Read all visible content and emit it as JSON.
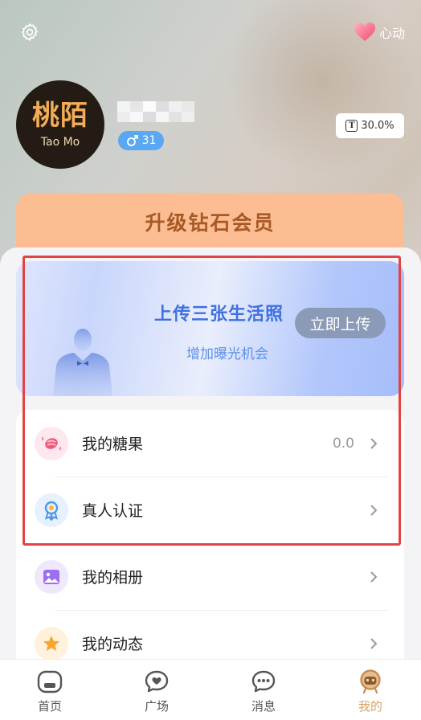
{
  "header": {
    "favorite_label": "心动",
    "avatar_logo_cn": "桃陌",
    "avatar_logo_en": "Tao Mo",
    "age": "31",
    "score": "30.0%"
  },
  "vip_banner": {
    "label": "升级钻石会员"
  },
  "upload_card": {
    "title": "上传三张生活照",
    "subtitle": "增加曝光机会",
    "button_label": "立即上传"
  },
  "menu": {
    "items": [
      {
        "label": "我的糖果",
        "value": "0.0",
        "icon": "candy-icon"
      },
      {
        "label": "真人认证",
        "value": "",
        "icon": "verify-badge-icon"
      },
      {
        "label": "我的相册",
        "value": "",
        "icon": "album-icon"
      },
      {
        "label": "我的动态",
        "value": "",
        "icon": "star-icon"
      }
    ]
  },
  "tabs": [
    {
      "label": "首页",
      "icon": "home-icon",
      "active": false
    },
    {
      "label": "广场",
      "icon": "square-chat-icon",
      "active": false
    },
    {
      "label": "消息",
      "icon": "message-icon",
      "active": false
    },
    {
      "label": "我的",
      "icon": "profile-icon",
      "active": true
    }
  ],
  "colors": {
    "vip_bg": "#fdbd93",
    "vip_text": "#a85a26",
    "active_tab": "#d9a268",
    "upload_title": "#3f70e0",
    "highlight_box": "#e24444",
    "age_badge": "#58a8f3"
  }
}
